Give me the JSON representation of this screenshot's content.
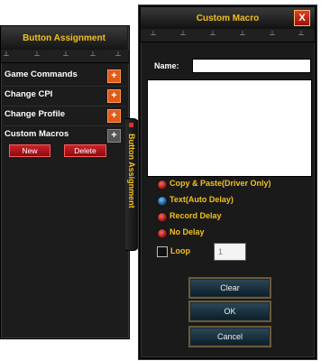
{
  "left_panel": {
    "title": "Button Assignment",
    "side_tab": "Button Assignment",
    "items": [
      {
        "label": "Game Commands",
        "action": "+"
      },
      {
        "label": "Change CPI",
        "action": "+"
      },
      {
        "label": "Change Profile",
        "action": "+"
      },
      {
        "label": "Custom Macros",
        "action": "+"
      }
    ],
    "new_label": "New",
    "delete_label": "Delete"
  },
  "dialog": {
    "title": "Custom Macro",
    "close_label": "X",
    "name_label": "Name:",
    "name_value": "",
    "macro_content": "",
    "options": [
      {
        "label": "Copy & Paste(Driver Only)",
        "selected": false
      },
      {
        "label": "Text(Auto Delay)",
        "selected": true
      },
      {
        "label": "Record Delay",
        "selected": false
      },
      {
        "label": "No Delay",
        "selected": false
      }
    ],
    "loop_label": "Loop",
    "loop_checked": false,
    "loop_count": "1",
    "buttons": {
      "clear": "Clear",
      "ok": "OK",
      "cancel": "Cancel"
    }
  },
  "colors": {
    "accent": "#f0c020",
    "panel": "#1a1a1a",
    "danger": "#d0202a"
  },
  "icons": [
    "plus-icon",
    "close-icon",
    "radio-icon",
    "checkbox-icon",
    "ruler-tick-icon"
  ]
}
